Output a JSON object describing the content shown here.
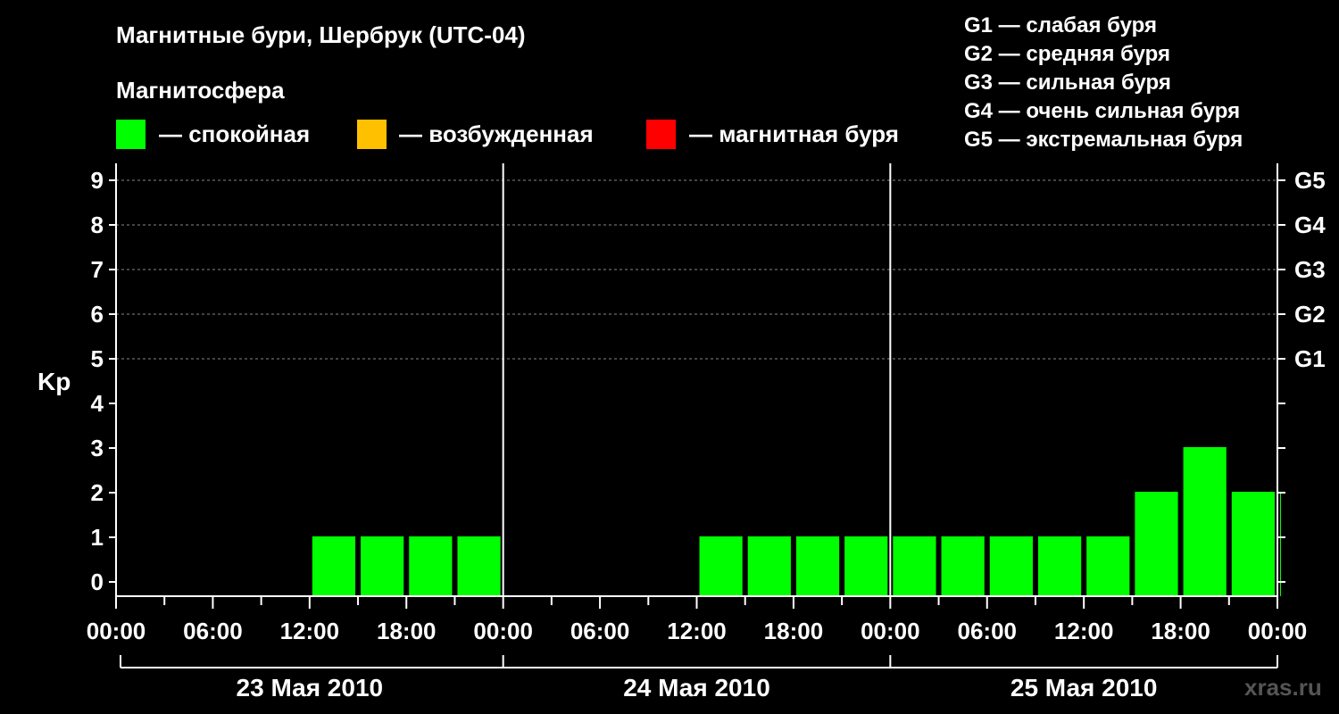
{
  "title": "Магнитные бури, Шербрук (UTC-04)",
  "subtitle": "Магнитосфера",
  "legend": [
    {
      "label": "— спокойная",
      "color": "#00ff00"
    },
    {
      "label": "— возбужденная",
      "color": "#ffc000"
    },
    {
      "label": "— магнитная буря",
      "color": "#ff0000"
    }
  ],
  "g_scale": [
    "G1 — слабая буря",
    "G2 — средняя буря",
    "G3 — сильная буря",
    "G4 — очень сильная буря",
    "G5 — экстремальная буря"
  ],
  "watermark": "xras.ru",
  "chart_data": {
    "type": "bar",
    "ylabel": "Kp",
    "ylim": [
      0,
      9
    ],
    "yticks": [
      "0",
      "1",
      "2",
      "3",
      "4",
      "5",
      "6",
      "7",
      "8",
      "9"
    ],
    "right_ticks": [
      {
        "kp": 5,
        "label": "G1"
      },
      {
        "kp": 6,
        "label": "G2"
      },
      {
        "kp": 7,
        "label": "G3"
      },
      {
        "kp": 8,
        "label": "G4"
      },
      {
        "kp": 9,
        "label": "G5"
      }
    ],
    "xtick_labels": [
      "00:00",
      "06:00",
      "12:00",
      "18:00",
      "00:00",
      "06:00",
      "12:00",
      "18:00",
      "00:00",
      "06:00",
      "12:00",
      "18:00",
      "00:00"
    ],
    "days": [
      "23 Мая 2010",
      "24 Мая 2010",
      "25 Мая 2010"
    ],
    "grid": "dashed horizontal at Kp 5-9",
    "bar_interval_hours": 3,
    "series": [
      {
        "values": [
          0,
          0,
          0,
          0,
          1,
          1,
          1,
          1,
          0,
          0,
          0,
          0,
          1,
          1,
          1,
          1,
          1,
          1,
          1,
          1,
          1,
          2,
          3,
          2,
          2
        ]
      }
    ],
    "partial_last_bar": true
  }
}
